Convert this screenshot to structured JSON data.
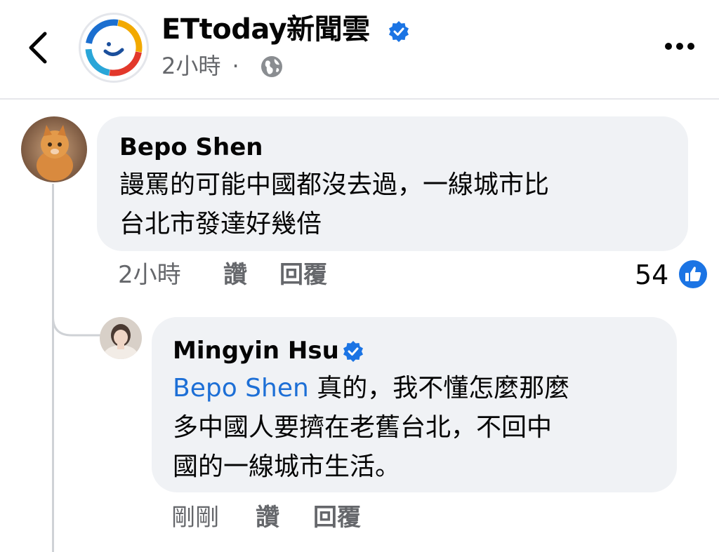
{
  "header": {
    "page_name": "ETtoday新聞雲",
    "post_time": "2小時",
    "separator": "·",
    "icons": {
      "back": "chevron-left-icon",
      "verified": "verified-badge-icon",
      "audience": "globe-icon",
      "more": "more-dots-icon"
    }
  },
  "comments": [
    {
      "author": "Bepo Shen",
      "text_lines": [
        "謾罵的可能中國都沒去過，一線城市比",
        "台北市發達好幾倍"
      ],
      "time": "2小時",
      "like_label": "讚",
      "reply_label": "回覆",
      "reaction_count": "54",
      "reaction_icon": "like-thumb-icon"
    }
  ],
  "replies": [
    {
      "author": "Mingyin Hsu",
      "verified": true,
      "mention": "Bepo Shen",
      "text_line1_rest": " 真的，我不懂怎麼那麼",
      "text_line2": "多中國人要擠在老舊台北，不回中",
      "text_line3": "國的一線城市生活。",
      "time": "剛剛",
      "like_label": "讚",
      "reply_label": "回覆"
    }
  ],
  "colors": {
    "bubble": "#f0f2f5",
    "secondary_text": "#65676b",
    "link": "#1d6fd6",
    "verified": "#1b74e4",
    "like": "#1b74e4"
  }
}
